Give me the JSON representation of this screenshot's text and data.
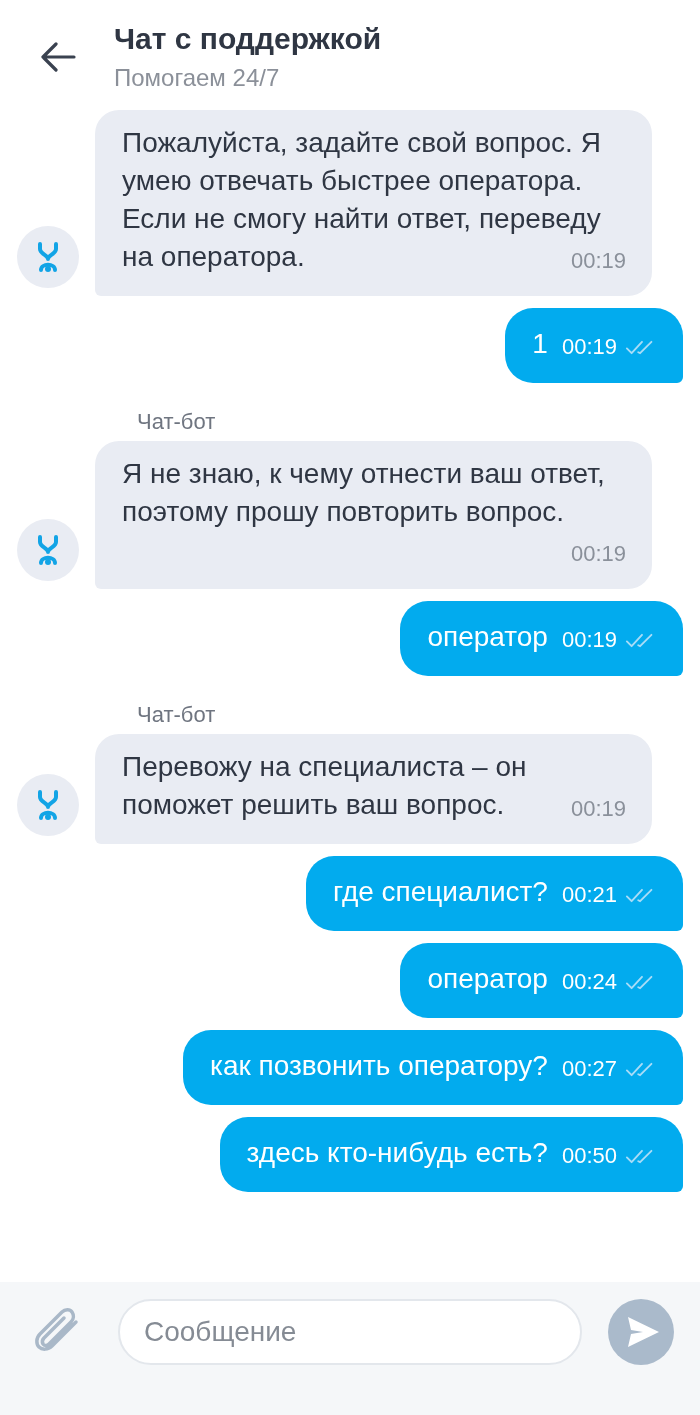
{
  "header": {
    "title": "Чат с поддержкой",
    "subtitle": "Помогаем 24/7"
  },
  "messages": [
    {
      "kind": "bot",
      "text": "Пожалуйста, задайте свой вопрос. Я умею отвечать быстрее оператора. Если не смогу найти ответ, переведу на оператора.",
      "time": "00:19"
    },
    {
      "kind": "user",
      "text": "1",
      "time": "00:19"
    },
    {
      "kind": "bot",
      "sender": "Чат-бот",
      "text": "Я не знаю, к чему отнести ваш ответ, поэтому прошу повторить вопрос.",
      "time": "00:19"
    },
    {
      "kind": "user",
      "text": "оператор",
      "time": "00:19"
    },
    {
      "kind": "bot",
      "sender": "Чат-бот",
      "text": "Перевожу на специалиста – он поможет решить ваш вопрос.",
      "time": "00:19"
    },
    {
      "kind": "user",
      "text": "где специалист?",
      "time": "00:21"
    },
    {
      "kind": "user",
      "text": "оператор",
      "time": "00:24"
    },
    {
      "kind": "user",
      "text": "как позвонить оператору?",
      "time": "00:27"
    },
    {
      "kind": "user",
      "text": "здесь кто-нибудь есть?",
      "time": "00:50"
    }
  ],
  "composer": {
    "placeholder": "Сообщение"
  }
}
